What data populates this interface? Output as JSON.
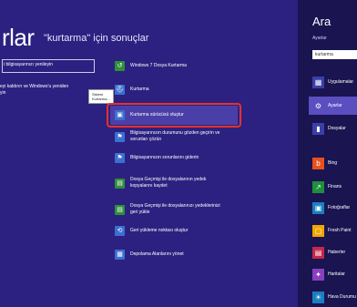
{
  "title": {
    "big": "rlar",
    "query": "\"kurtarma\" için sonuçlar"
  },
  "left": {
    "box_text": "i bilgisayarınızı yenileyin",
    "line2": "eyi kaldırın ve Windows'u yeniden",
    "line3": "yin",
    "tooltip_line1": "Sistem",
    "tooltip_line2": "Kurtarma..."
  },
  "results": [
    {
      "label": "Windows 7 Dosya Kurtarma",
      "icon": "file-recovery-icon",
      "color": "#2f8f3a",
      "glyph": "↺"
    },
    {
      "label": "Kurtarma",
      "icon": "recovery-icon",
      "color": "#3b6fd1",
      "glyph": "⛑"
    },
    {
      "label": "Kurtarma sürücüsü oluştur",
      "icon": "recovery-drive-icon",
      "color": "#3b6fd1",
      "glyph": "▣"
    },
    {
      "label": "Bilgisayarınızın durumunu gözden geçirin ve sorunları çözün",
      "icon": "action-center-flag-icon",
      "color": "#3b6fd1",
      "glyph": "⚑"
    },
    {
      "label": "Bilgisayarınızın sorunlarını giderin",
      "icon": "troubleshoot-flag-icon",
      "color": "#3b6fd1",
      "glyph": "⚑"
    },
    {
      "label": "Dosya Geçmişi ile dosyalarının yedek kopyalarını kaydet",
      "icon": "file-history-save-icon",
      "color": "#2f8f3a",
      "glyph": "▤"
    },
    {
      "label": "Dosya Geçmişi ile dosyalarınızı yedeklerinizi geri yükle",
      "icon": "file-history-restore-icon",
      "color": "#2f8f3a",
      "glyph": "▤"
    },
    {
      "label": "Geri yükleme noktası oluştur",
      "icon": "restore-point-icon",
      "color": "#3b6fd1",
      "glyph": "⟲"
    },
    {
      "label": "Depolama Alanlarını yönet",
      "icon": "storage-spaces-icon",
      "color": "#3b6fd1",
      "glyph": "▦"
    }
  ],
  "pane": {
    "heading": "Ara",
    "subheading": "Ayarlar",
    "search_value": "kurtarma",
    "items": [
      {
        "label": "Uygulamalar",
        "icon": "apps-icon",
        "color": "#3b3fa8",
        "glyph": "▦"
      },
      {
        "label": "Ayarlar",
        "icon": "settings-gear-icon",
        "color": "#5a4ec0",
        "glyph": "⚙"
      },
      {
        "label": "Dosyalar",
        "icon": "files-icon",
        "color": "#3b3fa8",
        "glyph": "▮"
      },
      {
        "label": "Bing",
        "icon": "bing-icon",
        "color": "#e8501e",
        "glyph": "b"
      },
      {
        "label": "Finans",
        "icon": "finance-icon",
        "color": "#1e8f3a",
        "glyph": "↗"
      },
      {
        "label": "Fotoğraflar",
        "icon": "photos-icon",
        "color": "#1a7fc2",
        "glyph": "▣"
      },
      {
        "label": "Fresh Paint",
        "icon": "fresh-paint-icon",
        "color": "#f0a500",
        "glyph": "▢"
      },
      {
        "label": "Haberler",
        "icon": "news-icon",
        "color": "#c4264d",
        "glyph": "▤"
      },
      {
        "label": "Haritalar",
        "icon": "maps-icon",
        "color": "#8a3fbf",
        "glyph": "✦"
      },
      {
        "label": "Hava Durumu",
        "icon": "weather-icon",
        "color": "#1a7fc2",
        "glyph": "☀"
      }
    ]
  }
}
